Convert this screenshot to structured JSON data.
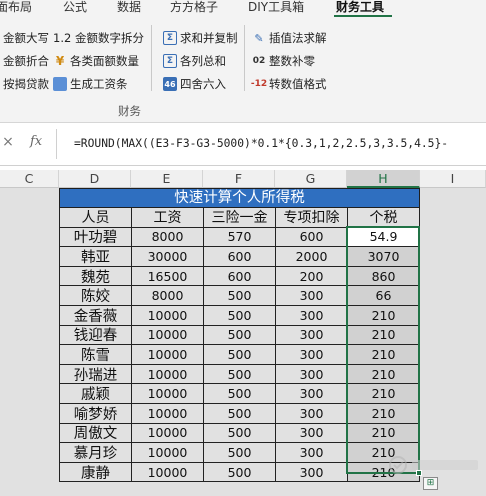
{
  "ribbon": {
    "tabs": [
      "面布局",
      "公式",
      "数据",
      "方方格子",
      "DIY工具箱",
      "财务工具"
    ],
    "active_tab": "财务工具",
    "items": [
      {
        "label": "金额大写",
        "icon": "currency-uppercase-icon"
      },
      {
        "label": "金额折合",
        "icon": "currency-convert-icon"
      },
      {
        "label": "按揭贷款",
        "icon": "mortgage-icon"
      },
      {
        "label": "1.2 金额数字拆分",
        "icon": "split-digits-icon"
      },
      {
        "label": "各类面额数量",
        "icon": "yen-denomination-icon"
      },
      {
        "label": "生成工资条",
        "icon": "payslip-icon"
      },
      {
        "label": "求和并复制",
        "icon": "sum-copy-icon"
      },
      {
        "label": "各列总和",
        "icon": "column-sum-icon"
      },
      {
        "label": "四舍六入",
        "icon": "round-half-even-icon"
      },
      {
        "label": "插值法求解",
        "icon": "interpolation-icon"
      },
      {
        "label": "整数补零",
        "icon": "zero-pad-icon"
      },
      {
        "label": "转数值格式",
        "icon": "to-number-icon"
      }
    ],
    "group_label": "财务"
  },
  "formula_bar": {
    "cancel_symbol": "×",
    "fx_label": "fx",
    "formula": "=ROUND(MAX((E3-F3-G3-5000)*0.1*{0.3,1,2,2.5,3,3.5,4.5}-"
  },
  "columns": [
    "C",
    "D",
    "E",
    "F",
    "G",
    "H",
    "I"
  ],
  "selected_column": "H",
  "table": {
    "title": "快速计算个人所得税",
    "headers": [
      "人员",
      "工资",
      "三险一金",
      "专项扣除",
      "个税"
    ],
    "rows": [
      [
        "叶功碧",
        "8000",
        "570",
        "600",
        "54.9"
      ],
      [
        "韩亚",
        "30000",
        "600",
        "2000",
        "3070"
      ],
      [
        "魏苑",
        "16500",
        "600",
        "200",
        "860"
      ],
      [
        "陈姣",
        "8000",
        "500",
        "300",
        "66"
      ],
      [
        "金香薇",
        "10000",
        "500",
        "300",
        "210"
      ],
      [
        "钱迎春",
        "10000",
        "500",
        "300",
        "210"
      ],
      [
        "陈雪",
        "10000",
        "500",
        "300",
        "210"
      ],
      [
        "孙瑞进",
        "10000",
        "500",
        "300",
        "210"
      ],
      [
        "戚颖",
        "10000",
        "500",
        "300",
        "210"
      ],
      [
        "喻梦娇",
        "10000",
        "500",
        "300",
        "210"
      ],
      [
        "周傲文",
        "10000",
        "500",
        "300",
        "210"
      ],
      [
        "慕月珍",
        "10000",
        "500",
        "300",
        "210"
      ],
      [
        "康静",
        "10000",
        "500",
        "300",
        "210"
      ]
    ]
  },
  "colors": {
    "accent_green": "#217346",
    "title_blue": "#2f6fc0",
    "selection_fill": "#d1d1d1"
  }
}
